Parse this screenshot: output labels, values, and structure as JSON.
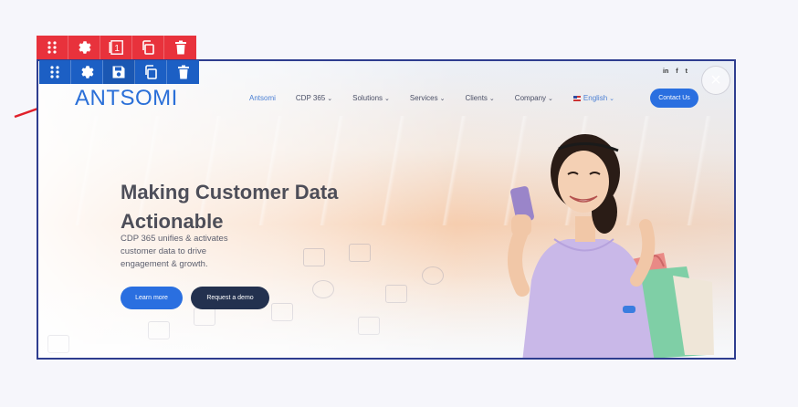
{
  "editor": {
    "red_toolbar": [
      "drag-handle-icon",
      "gear-icon",
      "slide-number-icon",
      "copy-icon",
      "trash-icon"
    ],
    "red_badge": "1",
    "blue_toolbar": [
      "drag-handle-icon",
      "gear-icon",
      "save-icon",
      "copy-icon",
      "trash-icon"
    ],
    "colors": {
      "red": "#e8323c",
      "blue": "#1c5fc4",
      "frame_border": "#2e3d8f",
      "arrow": "#e0202a"
    }
  },
  "site": {
    "logo": "ANTSOMI",
    "nav": [
      {
        "label": "Antsomi",
        "dropdown": false
      },
      {
        "label": "CDP 365",
        "dropdown": true
      },
      {
        "label": "Solutions",
        "dropdown": true
      },
      {
        "label": "Services",
        "dropdown": true
      },
      {
        "label": "Clients",
        "dropdown": true
      },
      {
        "label": "Company",
        "dropdown": true
      },
      {
        "label": "English",
        "dropdown": true
      }
    ],
    "social": [
      "in",
      "f",
      "t"
    ],
    "contact_label": "Contact Us"
  },
  "hero": {
    "headline": "Making Customer Data Actionable",
    "subtext": "CDP 365 unifies & activates customer data to drive engagement & growth.",
    "learn_more": "Learn more",
    "request_demo": "Request a demo"
  }
}
